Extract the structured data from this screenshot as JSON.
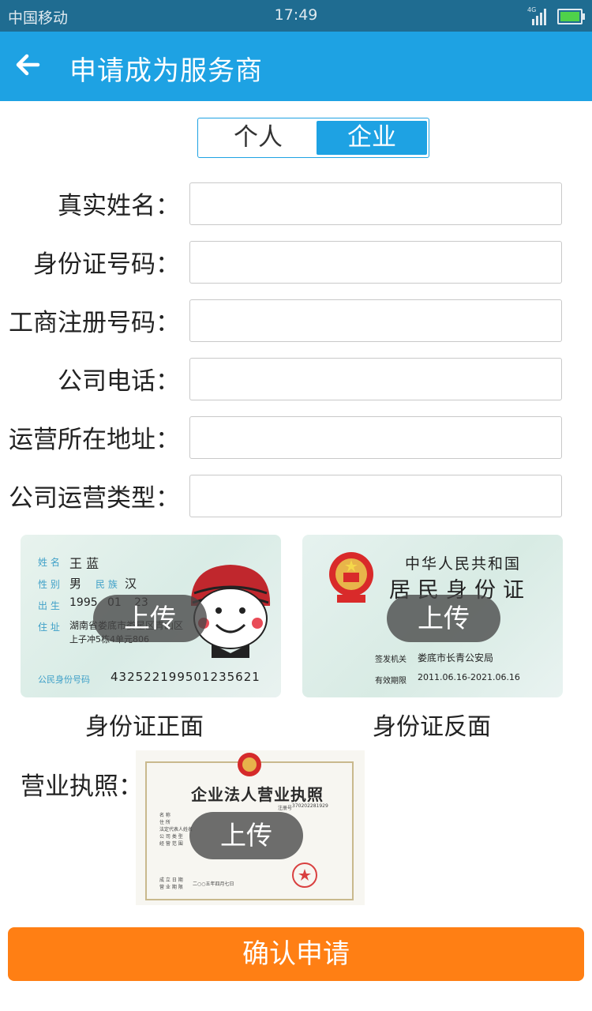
{
  "status_bar": {
    "carrier": "中国移动",
    "time": "17:49",
    "network": "4G"
  },
  "app_bar": {
    "back_icon": "arrow-left-icon",
    "title": "申请成为服务商"
  },
  "type_switch": {
    "options": [
      "个人",
      "企业"
    ],
    "selected": "企业"
  },
  "form": {
    "fields": [
      {
        "label": "真实姓名：",
        "value": ""
      },
      {
        "label": "身份证号码：",
        "value": ""
      },
      {
        "label": "工商注册号码：",
        "value": ""
      },
      {
        "label": "公司电话：",
        "value": ""
      },
      {
        "label": "运营所在地址：",
        "value": ""
      },
      {
        "label": "公司运营类型：",
        "value": ""
      }
    ]
  },
  "uploads": {
    "button_label": "上传",
    "id_front": {
      "caption": "身份证正面",
      "sample": {
        "name_key": "姓 名",
        "name": "王 蓝",
        "sex_key": "性 别",
        "sex": "男",
        "ethnic_key": "民 族",
        "ethnic": "汉",
        "birth_key": "出 生",
        "birth_year": "1995",
        "birth_month": "01",
        "birth_day": "23",
        "addr_key": "住 址",
        "addr_line1": "湖南省娄底市娄星区青山区",
        "addr_line2": "上子冲5栋4单元806",
        "id_key": "公民身份号码",
        "id_number": "432522199501235621"
      }
    },
    "id_back": {
      "caption": "身份证反面",
      "sample": {
        "country": "中华人民共和国",
        "doc_title": "居民身份证",
        "authority_key": "签发机关",
        "authority": "娄底市长青公安局",
        "valid_key": "有效期限",
        "valid": "2011.06.16-2021.06.16"
      }
    },
    "license": {
      "label": "营业执照：",
      "sample": {
        "doc_title": "企业法人营业执照",
        "reg_no_key": "注册号",
        "reg_no": "370202281929",
        "field_keys": [
          "名 称",
          "住 所",
          "法定代表人姓名",
          "公 司 类 型",
          "经 营 范 围",
          "成 立 日 期",
          "营 业 期 限"
        ],
        "issue_date": "二○○五年四月七日"
      }
    }
  },
  "submit": {
    "label": "确认申请"
  },
  "colors": {
    "status_bar": "#1f6c91",
    "app_bar": "#1ea2e3",
    "accent": "#1ea2e3",
    "submit": "#ff7f14"
  }
}
